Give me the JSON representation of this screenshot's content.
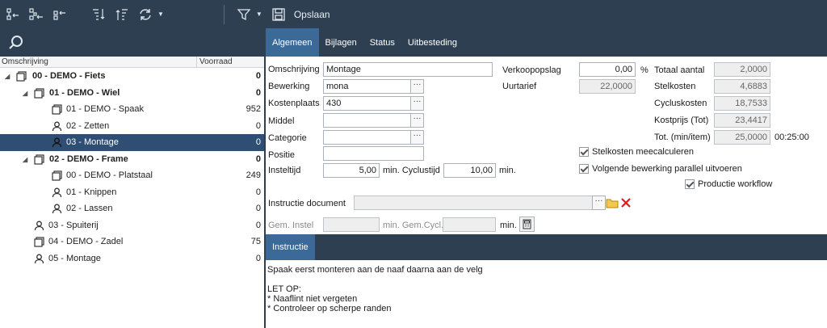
{
  "toolbar": {
    "save_label": "Opslaan",
    "buttons": [
      "collapse-all-icon",
      "collapse-level-icon",
      "collapse-child-icon",
      "expand-down-icon",
      "expand-up-icon",
      "refresh-icon",
      "filter-icon",
      "save-icon"
    ]
  },
  "tree": {
    "col_description": "Omschrijving",
    "col_stock": "Voorraad",
    "rows": [
      {
        "label": "00 - DEMO - Fiets",
        "value": "0"
      },
      {
        "label": "01 - DEMO - Wiel",
        "value": "0"
      },
      {
        "label": "01 - DEMO - Spaak",
        "value": "952"
      },
      {
        "label": "02 - Zetten",
        "value": "0"
      },
      {
        "label": "03 - Montage",
        "value": "0"
      },
      {
        "label": "02 - DEMO - Frame",
        "value": "0"
      },
      {
        "label": "00 - DEMO - Platstaal",
        "value": "249"
      },
      {
        "label": "01 - Knippen",
        "value": "0"
      },
      {
        "label": "02 - Lassen",
        "value": "0"
      },
      {
        "label": "03 - Spuiterij",
        "value": "0"
      },
      {
        "label": "04 - DEMO - Zadel",
        "value": "75"
      },
      {
        "label": "05 - Montage",
        "value": "0"
      }
    ]
  },
  "tabs": [
    "Algemeen",
    "Bijlagen",
    "Status",
    "Uitbesteding"
  ],
  "form": {
    "omschrijving_label": "Omschrijving",
    "omschrijving_value": "Montage",
    "bewerking_label": "Bewerking",
    "bewerking_value": "mona",
    "kostenplaats_label": "Kostenplaats",
    "kostenplaats_value": "430",
    "middel_label": "Middel",
    "categorie_label": "Categorie",
    "positie_label": "Positie",
    "insteltijd_label": "Insteltijd",
    "insteltijd_value": "5,00",
    "min_cyclustijd_label": "min. Cyclustijd",
    "cyclustijd_value": "10,00",
    "min_label": "min.",
    "verkoopopslag_label": "Verkoopopslag",
    "verkoopopslag_value": "0,00",
    "percent": "%",
    "uurtarief_label": "Uurtarief",
    "uurtarief_value": "22,0000",
    "totaal_aantal_label": "Totaal aantal",
    "totaal_aantal_value": "2,0000",
    "stelkosten_label": "Stelkosten",
    "stelkosten_value": "4,6883",
    "cycluskosten_label": "Cycluskosten",
    "cycluskosten_value": "18,7533",
    "kostprijs_label": "Kostprijs (Tot)",
    "kostprijs_value": "23,4417",
    "tot_label": "Tot. (min/item)",
    "tot_value": "25,0000",
    "tot_time": "00:25:00",
    "chk_stelkosten": "Stelkosten meecalculeren",
    "chk_volgende": "Volgende bewerking parallel uitvoeren",
    "chk_productie": "Productie workflow",
    "instructie_doc_label": "Instructie document",
    "gem_instel_label": "Gem. Instel",
    "gem_cycl_label": "min. Gem.Cycl.",
    "gem_min_label": "min.",
    "ellipsis": "···"
  },
  "instructie": {
    "tab_label": "Instructie",
    "lines": [
      "Spaak eerst monteren aan de naaf daarna aan de velg",
      "",
      "LET OP:",
      "* Naaflint niet vergeten",
      "* Controleer op scherpe randen"
    ]
  },
  "colors": {
    "header": "#2e3f52",
    "active_tab": "#3b6a98",
    "selected_row": "#2e4f73"
  }
}
